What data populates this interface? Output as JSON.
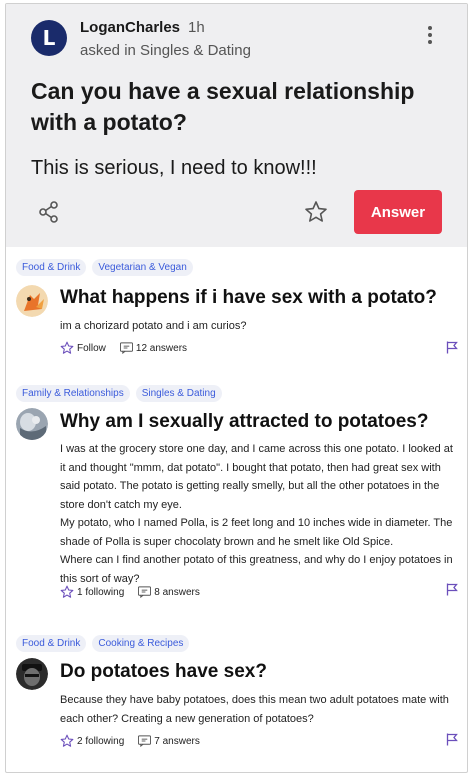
{
  "question": {
    "author": "LoganCharles",
    "avatar_letter": "L",
    "time": "1h",
    "asked_in": "asked in Singles & Dating",
    "title": "Can you have a sexual relationship with a potato?",
    "body": "This is serious, I need to know!!!",
    "answer_button": "Answer"
  },
  "feed": [
    {
      "tags": [
        "Food & Drink",
        "Vegetarian & Vegan"
      ],
      "title": "What happens if i have sex with a potato?",
      "body": [
        "im a chorizard potato and i am curios?"
      ],
      "follow_label": "Follow",
      "answers_label": "12 answers"
    },
    {
      "tags": [
        "Family & Relationships",
        "Singles & Dating"
      ],
      "title": "Why am I sexually attracted to potatoes?",
      "body": [
        "I was at the grocery store one day, and I came across this one potato. I looked at it and thought \"mmm, dat potato\". I bought that potato, then had great sex with said potato. The potato is getting really smelly, but all the other potatoes in the store don't catch my eye.",
        "My potato, who I named Polla, is 2 feet long and 10 inches wide in diameter. The shade of Polla is super chocolaty brown and he smelt like Old Spice.",
        "Where can I find another potato of this greatness, and why do I enjoy potatoes in this sort of way?"
      ],
      "follow_label": "1 following",
      "answers_label": "8 answers"
    },
    {
      "tags": [
        "Food & Drink",
        "Cooking & Recipes"
      ],
      "title": "Do potatoes have sex?",
      "body": [
        "Because they have baby potatoes, does this mean two adult potatoes mate with each other? Creating a new generation of potatoes?"
      ],
      "follow_label": "2 following",
      "answers_label": "7 answers"
    }
  ],
  "colors": {
    "accent": "#e8374a",
    "tag_text": "#3b5bdb",
    "tag_bg": "#eef0f7",
    "flag": "#6b4fbb",
    "header_bg": "#efeff1"
  }
}
